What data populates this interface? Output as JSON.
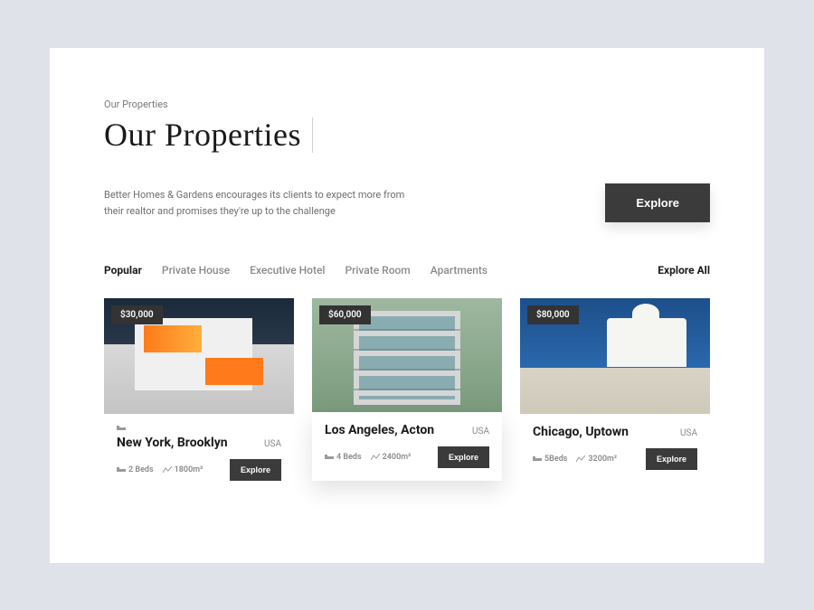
{
  "header": {
    "eyebrow": "Our Properties",
    "title": "Our  Properties",
    "intro": "Better Homes & Gardens encourages its clients to expect more from their realtor and promises they're up to the challenge",
    "explore_button": "Explore"
  },
  "tabs": {
    "items": [
      "Popular",
      "Private House",
      "Executive Hotel",
      "Private Room",
      "Apartments"
    ],
    "active_index": 0,
    "explore_all": "Explore All"
  },
  "cards": [
    {
      "price": "$30,000",
      "city": "New York, Brooklyn",
      "country": "USA",
      "beds": "2 Beds",
      "area": "1800m²",
      "cta": "Explore",
      "featured": false,
      "show_bed_mini": true
    },
    {
      "price": "$60,000",
      "city": "Los Angeles, Acton",
      "country": "USA",
      "beds": "4 Beds",
      "area": "2400m²",
      "cta": "Explore",
      "featured": true,
      "show_bed_mini": false
    },
    {
      "price": "$80,000",
      "city": "Chicago, Uptown",
      "country": "USA",
      "beds": "5Beds",
      "area": "3200m²",
      "cta": "Explore",
      "featured": false,
      "show_bed_mini": false
    }
  ]
}
